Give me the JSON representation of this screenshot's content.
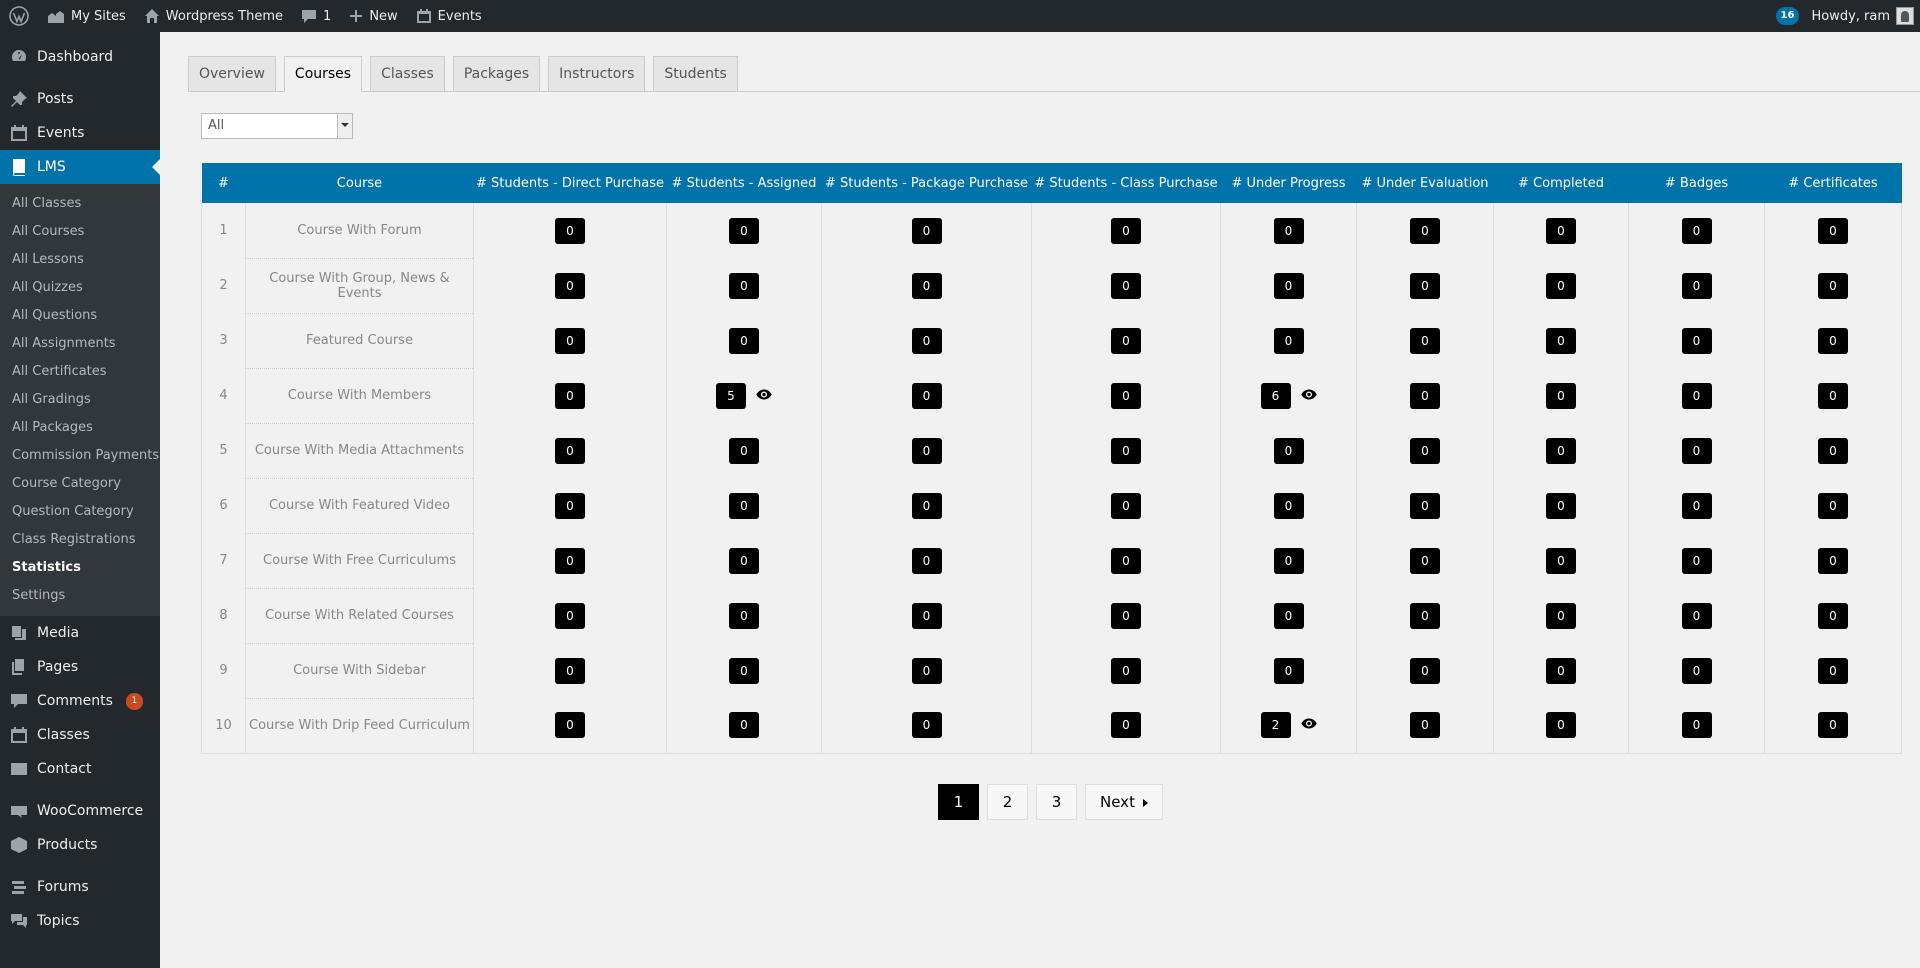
{
  "adminbar": {
    "my_sites": "My Sites",
    "site_name": "Wordpress Theme",
    "comments_count": "1",
    "new_label": "New",
    "events_label": "Events",
    "updates_badge": "16",
    "howdy": "Howdy, ram"
  },
  "sidebar": {
    "dashboard": "Dashboard",
    "posts": "Posts",
    "events": "Events",
    "lms": "LMS",
    "lms_submenu": [
      "All Classes",
      "All Courses",
      "All Lessons",
      "All Quizzes",
      "All Questions",
      "All Assignments",
      "All Certificates",
      "All Gradings",
      "All Packages",
      "Commission Payments",
      "Course Category",
      "Question Category",
      "Class Registrations",
      "Statistics",
      "Settings"
    ],
    "media": "Media",
    "pages": "Pages",
    "comments": "Comments",
    "comments_badge": "1",
    "classes": "Classes",
    "contact": "Contact",
    "woocommerce": "WooCommerce",
    "products": "Products",
    "forums": "Forums",
    "topics": "Topics"
  },
  "tabs": [
    "Overview",
    "Courses",
    "Classes",
    "Packages",
    "Instructors",
    "Students"
  ],
  "active_tab": "Courses",
  "filter": {
    "selected": "All"
  },
  "table": {
    "headers": [
      "#",
      "Course",
      "# Students - Direct Purchase",
      "# Students - Assigned",
      "# Students - Package Purchase",
      "# Students - Class Purchase",
      "# Under Progress",
      "# Under Evaluation",
      "# Completed",
      "# Badges",
      "# Certificates"
    ],
    "rows": [
      {
        "idx": "1",
        "course": "Course With Forum",
        "values": [
          "0",
          "0",
          "0",
          "0",
          "0",
          "0",
          "0",
          "0",
          "0"
        ]
      },
      {
        "idx": "2",
        "course": "Course With Group, News & Events",
        "values": [
          "0",
          "0",
          "0",
          "0",
          "0",
          "0",
          "0",
          "0",
          "0"
        ]
      },
      {
        "idx": "3",
        "course": "Featured Course",
        "values": [
          "0",
          "0",
          "0",
          "0",
          "0",
          "0",
          "0",
          "0",
          "0"
        ]
      },
      {
        "idx": "4",
        "course": "Course With Members",
        "values": [
          "0",
          "5",
          "0",
          "0",
          "6",
          "0",
          "0",
          "0",
          "0"
        ],
        "eyes": [
          1,
          4
        ]
      },
      {
        "idx": "5",
        "course": "Course With Media Attachments",
        "values": [
          "0",
          "0",
          "0",
          "0",
          "0",
          "0",
          "0",
          "0",
          "0"
        ]
      },
      {
        "idx": "6",
        "course": "Course With Featured Video",
        "values": [
          "0",
          "0",
          "0",
          "0",
          "0",
          "0",
          "0",
          "0",
          "0"
        ]
      },
      {
        "idx": "7",
        "course": "Course With Free Curriculums",
        "values": [
          "0",
          "0",
          "0",
          "0",
          "0",
          "0",
          "0",
          "0",
          "0"
        ]
      },
      {
        "idx": "8",
        "course": "Course With Related Courses",
        "values": [
          "0",
          "0",
          "0",
          "0",
          "0",
          "0",
          "0",
          "0",
          "0"
        ]
      },
      {
        "idx": "9",
        "course": "Course With Sidebar",
        "values": [
          "0",
          "0",
          "0",
          "0",
          "0",
          "0",
          "0",
          "0",
          "0"
        ]
      },
      {
        "idx": "10",
        "course": "Course With Drip Feed Curriculum",
        "values": [
          "0",
          "0",
          "0",
          "0",
          "2",
          "0",
          "0",
          "0",
          "0"
        ],
        "eyes": [
          4
        ]
      }
    ]
  },
  "pagination": {
    "pages": [
      "1",
      "2",
      "3"
    ],
    "current": "1",
    "next_label": "Next"
  }
}
